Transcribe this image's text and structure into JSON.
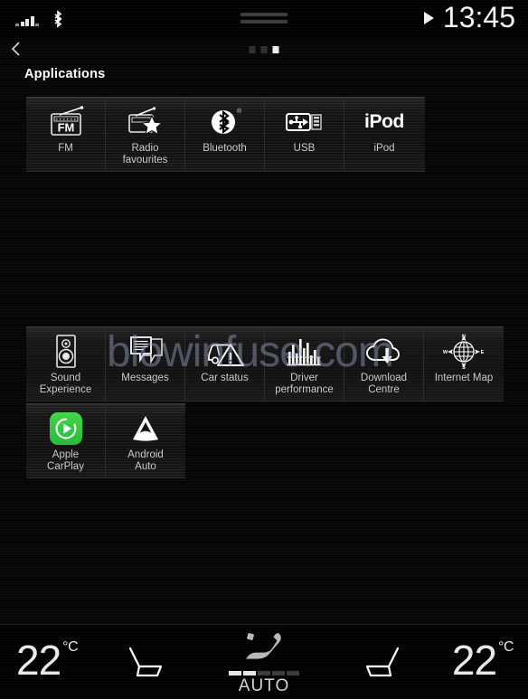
{
  "status_bar": {
    "signal_icon": "signal-bars-icon",
    "bluetooth_icon": "bluetooth-icon",
    "play_icon": "play-icon",
    "time": "13:45"
  },
  "nav": {
    "back_icon": "back-chevron-icon",
    "page_dots": [
      {
        "active": false
      },
      {
        "active": false
      },
      {
        "active": true
      }
    ]
  },
  "header": {
    "title": "Applications"
  },
  "watermark": {
    "text": "blowinfuse.com",
    "color": "#96a5c3"
  },
  "app_rows": [
    {
      "id": "row-top",
      "tiles": [
        {
          "label": "FM",
          "icon": "fm-radio-icon"
        },
        {
          "label": "Radio\nfavourites",
          "icon": "radio-favourites-icon"
        },
        {
          "label": "Bluetooth",
          "icon": "bluetooth-icon"
        },
        {
          "label": "USB",
          "icon": "usb-icon"
        },
        {
          "label": "iPod",
          "icon": "ipod-wordmark-icon",
          "icon_text": "iPod"
        }
      ]
    },
    {
      "id": "row-mid",
      "tiles": [
        {
          "label": "Sound\nExperience",
          "icon": "speaker-icon"
        },
        {
          "label": "Messages",
          "icon": "message-icon"
        },
        {
          "label": "Car status",
          "icon": "car-warning-icon"
        },
        {
          "label": "Driver\nperformance",
          "icon": "bar-chart-icon"
        },
        {
          "label": "Download\nCentre",
          "icon": "cloud-download-icon"
        },
        {
          "label": "Internet Map",
          "icon": "compass-icon"
        }
      ]
    },
    {
      "id": "row-bot",
      "tiles": [
        {
          "label": "Apple\nCarPlay",
          "icon": "apple-carplay-icon",
          "badge_color": "#2fc63d"
        },
        {
          "label": "Android\nAuto",
          "icon": "android-auto-icon"
        }
      ]
    }
  ],
  "compass": {
    "north": "N",
    "south": "S",
    "east": "E",
    "west": "W"
  },
  "climate": {
    "left_temp": "22",
    "left_unit": "°C",
    "right_temp": "22",
    "right_unit": "°C",
    "left_seat_icon": "seat-heater-left-icon",
    "right_seat_icon": "seat-heater-right-icon",
    "auto_icon": "auto-climate-seat-fan-icon",
    "auto_label": "AUTO",
    "fan_bars": [
      {
        "on": true
      },
      {
        "on": true
      },
      {
        "on": false
      },
      {
        "on": false
      },
      {
        "on": false
      }
    ]
  }
}
